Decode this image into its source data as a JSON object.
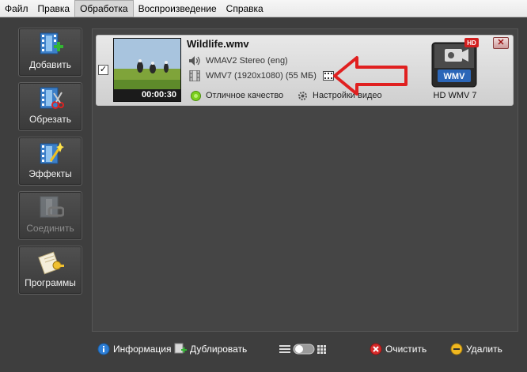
{
  "menu": {
    "items": [
      "Файл",
      "Правка",
      "Обработка",
      "Воспроизведение",
      "Справка"
    ],
    "active_index": 2
  },
  "tools": [
    {
      "label": "Добавить",
      "icon": "add-film-icon",
      "enabled": true
    },
    {
      "label": "Обрезать",
      "icon": "cut-film-icon",
      "enabled": true
    },
    {
      "label": "Эффекты",
      "icon": "effects-film-icon",
      "enabled": true
    },
    {
      "label": "Соединить",
      "icon": "join-film-icon",
      "enabled": false
    },
    {
      "label": "Программы",
      "icon": "programs-icon",
      "enabled": true
    }
  ],
  "file": {
    "name": "Wildlife.wmv",
    "checked": true,
    "duration": "00:00:30",
    "audio": "WMAV2 Stereo (eng)",
    "video": "WMV7 (1920x1080) (55 МБ)",
    "quality_label": "Отличное качество",
    "settings_label": "Настройки видео",
    "format_badge": "HD",
    "format_icon_text": "WMV",
    "format_label": "HD WMV 7"
  },
  "bottom": {
    "info_label": "Информация",
    "duplicate_label": "Дублировать",
    "clear_label": "Очистить",
    "delete_label": "Удалить"
  },
  "colors": {
    "app_background": "#3e3e3e",
    "annotation_arrow": "#e02020",
    "quality_dot": "#7ccf1f"
  }
}
